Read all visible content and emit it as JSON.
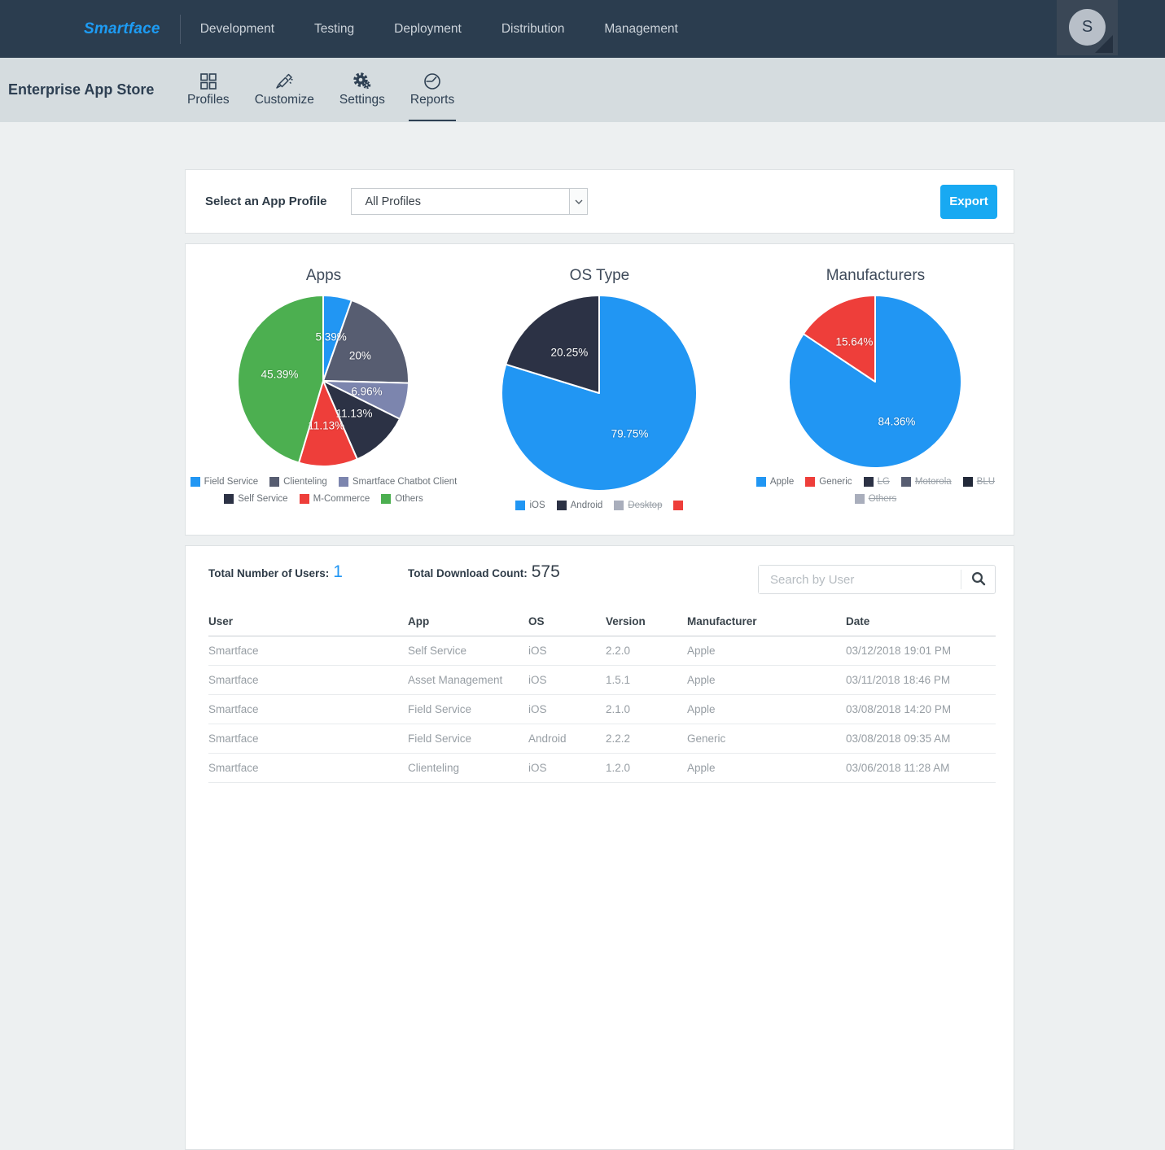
{
  "navbar": {
    "logo": "Smartface",
    "items": [
      {
        "label": "Development"
      },
      {
        "label": "Testing"
      },
      {
        "label": "Deployment"
      },
      {
        "label": "Distribution"
      },
      {
        "label": "Management"
      }
    ],
    "avatar_initial": "S"
  },
  "subheader": {
    "title": "Enterprise App Store",
    "tabs": [
      {
        "label": "Profiles",
        "icon": "grid-icon",
        "active": false
      },
      {
        "label": "Customize",
        "icon": "brush-icon",
        "active": false
      },
      {
        "label": "Settings",
        "icon": "gear-icon",
        "active": false
      },
      {
        "label": "Reports",
        "icon": "clock-icon",
        "active": true
      }
    ]
  },
  "profile_panel": {
    "label": "Select an App Profile",
    "dropdown_value": "All Profiles",
    "export_label": "Export"
  },
  "chart_data": [
    {
      "type": "pie",
      "title": "Apps",
      "slices": [
        {
          "label": "Field Service",
          "value": 5.39,
          "display": "5.39%",
          "color": "#2196f3"
        },
        {
          "label": "Clienteling",
          "value": 20.0,
          "display": "20%",
          "color": "#575d71"
        },
        {
          "label": "Smartface Chatbot Client",
          "value": 6.96,
          "display": "6.96%",
          "color": "#7c85ae"
        },
        {
          "label": "Self Service",
          "value": 11.13,
          "display": "11.13%",
          "color": "#2c3245"
        },
        {
          "label": "M-Commerce",
          "value": 11.13,
          "display": "11.13%",
          "color": "#ee3e3a"
        },
        {
          "label": "Others",
          "value": 45.39,
          "display": "45.39%",
          "color": "#4caf50"
        }
      ],
      "legend": [
        {
          "label": "Field Service",
          "color": "#2196f3",
          "disabled": false
        },
        {
          "label": "Clienteling",
          "color": "#575d71",
          "disabled": false
        },
        {
          "label": "Smartface Chatbot Client",
          "color": "#7c85ae",
          "disabled": false
        },
        {
          "label": "Self Service",
          "color": "#2c3245",
          "disabled": false
        },
        {
          "label": "M-Commerce",
          "color": "#ee3e3a",
          "disabled": false
        },
        {
          "label": "Others",
          "color": "#4caf50",
          "disabled": false
        }
      ]
    },
    {
      "type": "pie",
      "title": "OS Type",
      "slices": [
        {
          "label": "iOS",
          "value": 79.75,
          "display": "79.75%",
          "color": "#2196f3"
        },
        {
          "label": "Android",
          "value": 20.25,
          "display": "20.25%",
          "color": "#2c3245"
        }
      ],
      "legend": [
        {
          "label": "iOS",
          "color": "#2196f3",
          "disabled": false
        },
        {
          "label": "Android",
          "color": "#2c3245",
          "disabled": false
        },
        {
          "label": "Desktop",
          "color": "#a9aebc",
          "disabled": true
        },
        {
          "label": "",
          "color": "#ee3e3a",
          "disabled": true
        }
      ]
    },
    {
      "type": "pie",
      "title": "Manufacturers",
      "slices": [
        {
          "label": "Apple",
          "value": 84.36,
          "display": "84.36%",
          "color": "#2196f3"
        },
        {
          "label": "Generic",
          "value": 15.64,
          "display": "15.64%",
          "color": "#ee3e3a"
        }
      ],
      "legend": [
        {
          "label": "Apple",
          "color": "#2196f3",
          "disabled": false
        },
        {
          "label": "Generic",
          "color": "#ee3e3a",
          "disabled": false
        },
        {
          "label": "LG",
          "color": "#2c3245",
          "disabled": true
        },
        {
          "label": "Motorola",
          "color": "#575d71",
          "disabled": true
        },
        {
          "label": "BLU",
          "color": "#222939",
          "disabled": true
        },
        {
          "label": "Others",
          "color": "#a9aebc",
          "disabled": true
        }
      ]
    }
  ],
  "stats": {
    "users_label": "Total Number of Users:",
    "users_value": "1",
    "downloads_label": "Total Download Count:",
    "downloads_value": "575"
  },
  "search": {
    "placeholder": "Search by User"
  },
  "table": {
    "columns": [
      "User",
      "App",
      "OS",
      "Version",
      "Manufacturer",
      "Date"
    ],
    "rows": [
      [
        "Smartface",
        "Self Service",
        "iOS",
        "2.2.0",
        "Apple",
        "03/12/2018 19:01 PM"
      ],
      [
        "Smartface",
        "Asset Management",
        "iOS",
        "1.5.1",
        "Apple",
        "03/11/2018 18:46 PM"
      ],
      [
        "Smartface",
        "Field Service",
        "iOS",
        "2.1.0",
        "Apple",
        "03/08/2018 14:20 PM"
      ],
      [
        "Smartface",
        "Field Service",
        "Android",
        "2.2.2",
        "Generic",
        "03/08/2018 09:35 AM"
      ],
      [
        "Smartface",
        "Clienteling",
        "iOS",
        "1.2.0",
        "Apple",
        "03/06/2018 11:28 AM"
      ]
    ]
  },
  "colors": {
    "accent_blue": "#18a9f2",
    "navbar_bg": "#2b3d4f",
    "subheader_bg": "#d5dcdf",
    "page_bg": "#edf0f1"
  }
}
